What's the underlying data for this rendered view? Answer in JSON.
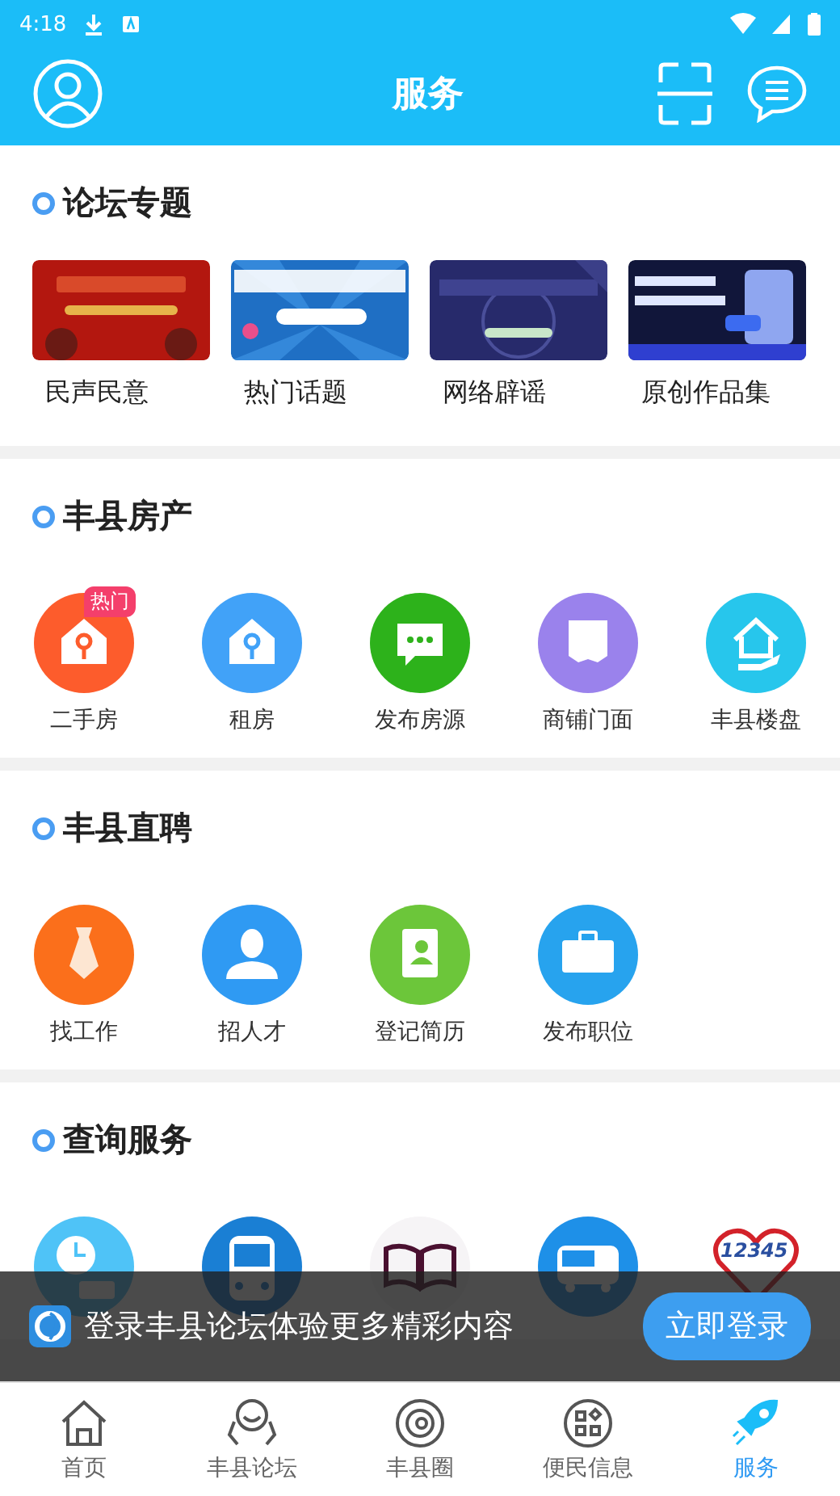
{
  "status_bar": {
    "time": "4:18"
  },
  "header": {
    "title": "服务"
  },
  "sections": [
    {
      "title": "论坛专题",
      "kind": "banners",
      "items": [
        {
          "label": "民声民意",
          "color": "#b3170f"
        },
        {
          "label": "热门话题",
          "color": "#1f6fc4"
        },
        {
          "label": "网络辟谣",
          "color": "#272a6b"
        },
        {
          "label": "原创作品集",
          "color": "#11163a"
        }
      ]
    },
    {
      "title": "丰县房产",
      "kind": "icons",
      "items": [
        {
          "label": "二手房",
          "color": "#fd5c2c",
          "badge": "热门"
        },
        {
          "label": "租房",
          "color": "#41a2f8"
        },
        {
          "label": "发布房源",
          "color": "#2db21b"
        },
        {
          "label": "商铺门面",
          "color": "#9a82ec"
        },
        {
          "label": "丰县楼盘",
          "color": "#27c6ec"
        }
      ]
    },
    {
      "title": "丰县直聘",
      "kind": "icons",
      "items": [
        {
          "label": "找工作",
          "color": "#fb6f1b"
        },
        {
          "label": "招人才",
          "color": "#2f9af3"
        },
        {
          "label": "登记简历",
          "color": "#6cc63a"
        },
        {
          "label": "发布职位",
          "color": "#27a3ee"
        }
      ]
    },
    {
      "title": "查询服务",
      "kind": "icons",
      "items": [
        {
          "color": "#4fc3f7"
        },
        {
          "color": "#1a7fd4"
        },
        {
          "color": "#f6f4f6"
        },
        {
          "color": "#1e90e8"
        },
        {
          "logo": "12345"
        }
      ]
    }
  ],
  "login_banner": {
    "text": "登录丰县论坛体验更多精彩内容",
    "button": "立即登录"
  },
  "bottom_nav": [
    {
      "label": "首页",
      "selected": false
    },
    {
      "label": "丰县论坛",
      "selected": false
    },
    {
      "label": "丰县圈",
      "selected": false
    },
    {
      "label": "便民信息",
      "selected": false
    },
    {
      "label": "服务",
      "selected": true
    }
  ]
}
